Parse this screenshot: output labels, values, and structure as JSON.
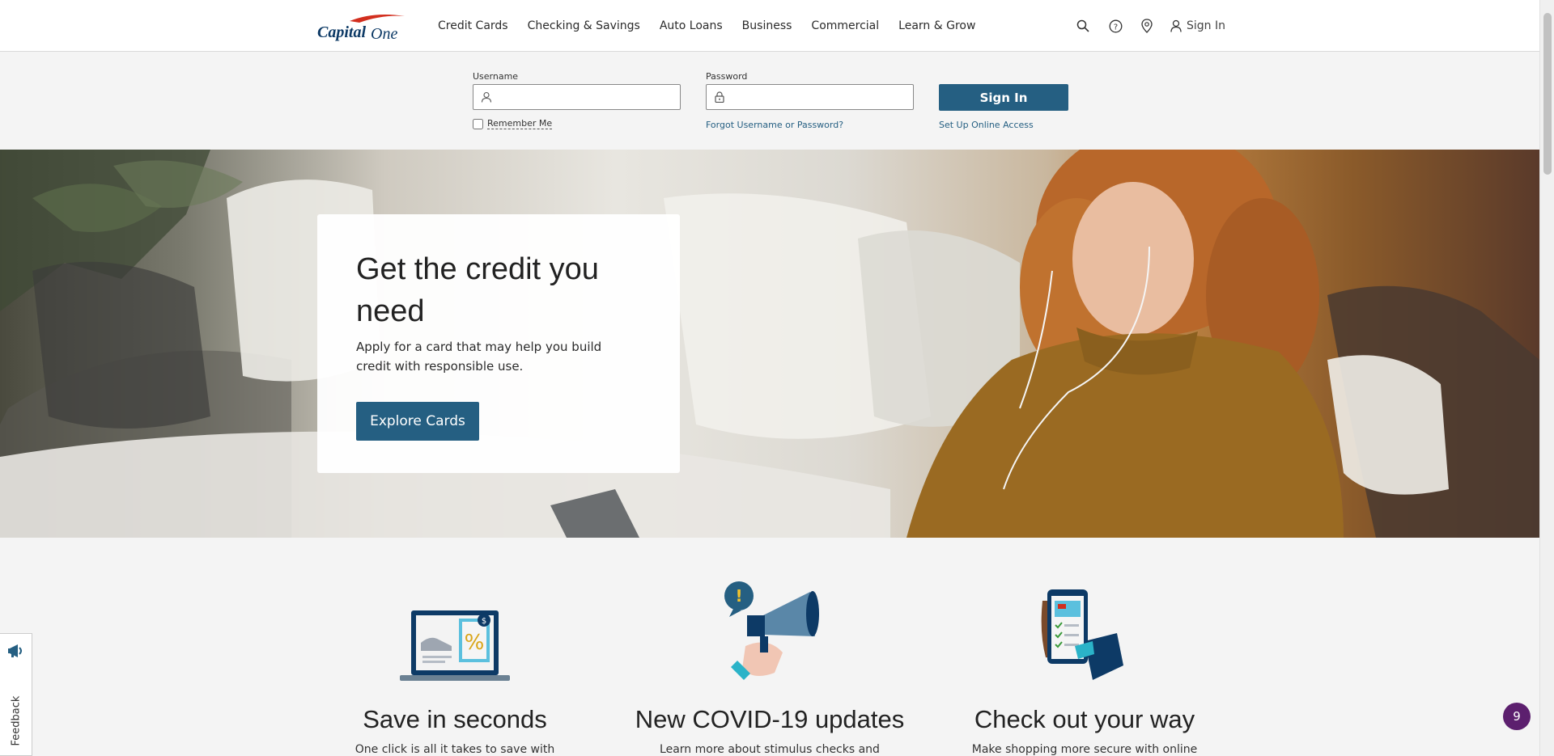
{
  "header": {
    "logo_alt": "Capital One",
    "nav": [
      {
        "label": "Credit Cards"
      },
      {
        "label": "Checking & Savings"
      },
      {
        "label": "Auto Loans"
      },
      {
        "label": "Business"
      },
      {
        "label": "Commercial"
      },
      {
        "label": "Learn & Grow"
      }
    ],
    "signin_label": "Sign In"
  },
  "signin_form": {
    "username_label": "Username",
    "username_value": "",
    "password_label": "Password",
    "password_value": "",
    "remember_label": "Remember Me",
    "forgot_link": "Forgot Username or Password?",
    "setup_link": "Set Up Online Access",
    "submit_label": "Sign In"
  },
  "hero": {
    "title": "Get the credit you need",
    "subtitle": "Apply for a card that may help you build credit with responsible use.",
    "cta_label": "Explore Cards"
  },
  "features": [
    {
      "title": "Save in seconds",
      "text": "One click is all it takes to save with"
    },
    {
      "title": "New COVID-19 updates",
      "text": "Learn more about stimulus checks and"
    },
    {
      "title": "Check out your way",
      "text": "Make shopping more secure with online"
    }
  ],
  "feedback": {
    "label": "Feedback"
  },
  "notification_badge": {
    "count": "9"
  },
  "colors": {
    "brand_blue": "#255f82",
    "logo_navy": "#0d3a66",
    "logo_red": "#d22e1e",
    "badge_purple": "#5c1f6e"
  }
}
